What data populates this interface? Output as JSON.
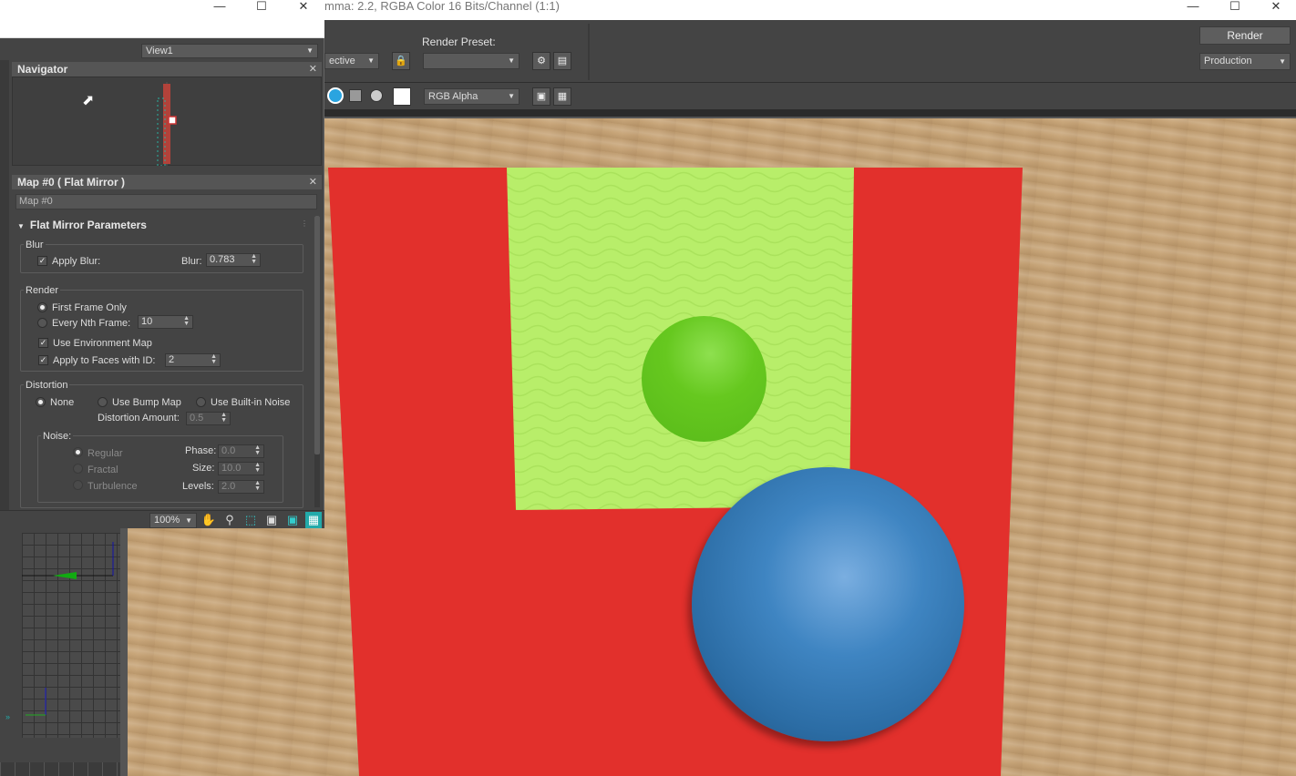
{
  "framebuffer": {
    "title": "mma: 2.2, RGBA Color 16 Bits/Channel (1:1)",
    "area_value": "ective",
    "render_preset_label": "Render Preset:",
    "render_preset_value": "",
    "channel_value": "RGB Alpha",
    "render_button": "Render",
    "production_value": "Production"
  },
  "material_editor": {
    "view_value": "View1",
    "navigator_title": "Navigator",
    "map_panel_title": "Map #0  ( Flat Mirror )",
    "map_name": "Map #0",
    "rollout_title": "Flat Mirror Parameters",
    "blur": {
      "group": "Blur",
      "apply_blur": "Apply Blur:",
      "blur_label": "Blur:",
      "blur_value": "0.783"
    },
    "render": {
      "group": "Render",
      "first_frame": "First Frame Only",
      "every_nth": "Every Nth Frame:",
      "nth_value": "10",
      "use_env": "Use Environment Map",
      "apply_faces": "Apply to Faces with ID:",
      "face_id": "2"
    },
    "distortion": {
      "group": "Distortion",
      "none": "None",
      "bump": "Use Bump Map",
      "builtin": "Use Built-in Noise",
      "amount_label": "Distortion Amount:",
      "amount_value": "0.5"
    },
    "noise": {
      "group": "Noise:",
      "regular": "Regular",
      "fractal": "Fractal",
      "turbulence": "Turbulence",
      "phase_label": "Phase:",
      "phase_value": "0.0",
      "size_label": "Size:",
      "size_value": "10.0",
      "levels_label": "Levels:",
      "levels_value": "2.0"
    },
    "zoom_value": "100%"
  },
  "colors": {
    "panel_bg": "#444444",
    "mirror_red": "#e2302c",
    "reflection_green": "#b8ee6a",
    "sphere_blue": "#3f85c2",
    "sphere_green": "#66c81f",
    "wood": "#c9a77b"
  },
  "icons": [
    "minimize-icon",
    "maximize-icon",
    "close-icon",
    "lock-icon",
    "hand-icon",
    "zoom-icon",
    "region-zoom-icon",
    "render-setup-icon"
  ]
}
